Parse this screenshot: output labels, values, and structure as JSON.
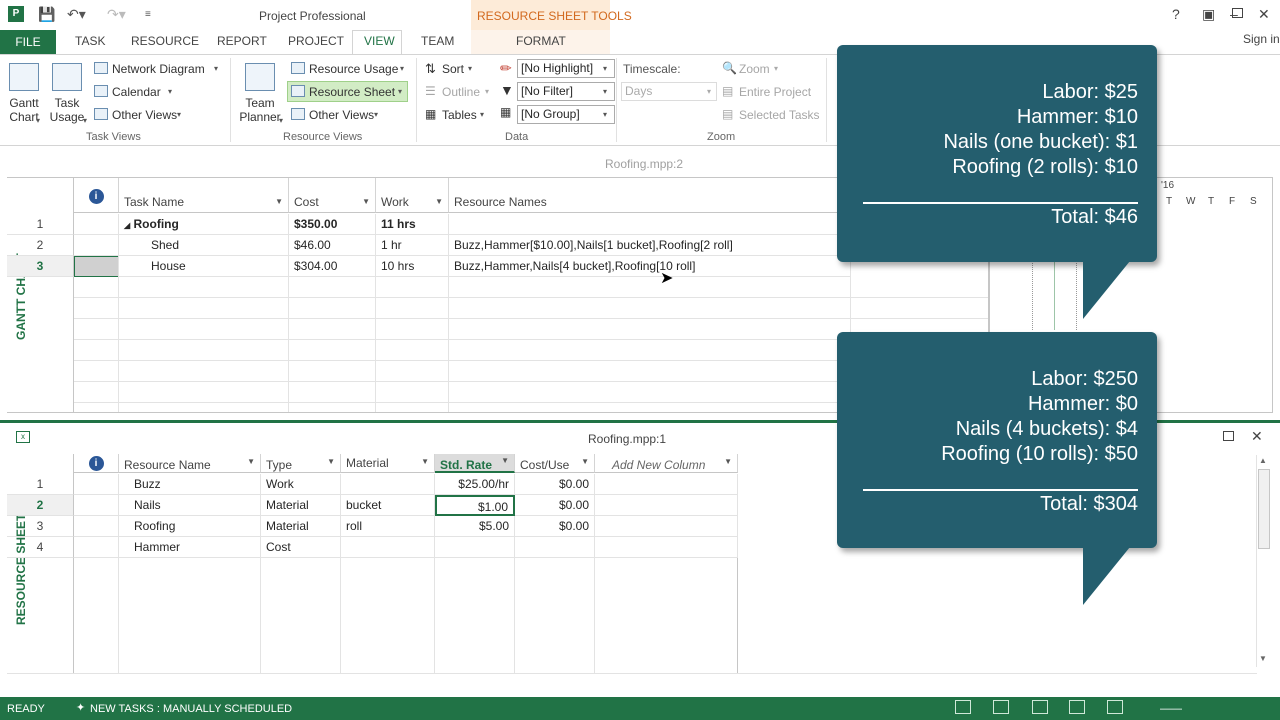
{
  "window": {
    "title": "Project Professional",
    "contextual_tab_group": "RESOURCE SHEET TOOLS",
    "sign_in": "Sign in"
  },
  "tabs": [
    "FILE",
    "TASK",
    "RESOURCE",
    "REPORT",
    "PROJECT",
    "VIEW",
    "TEAM",
    "FORMAT"
  ],
  "ribbon": {
    "task_views": {
      "group_label": "Task Views",
      "gantt_chart": [
        "Gantt",
        "Chart"
      ],
      "task_usage": [
        "Task",
        "Usage"
      ],
      "network_diagram": "Network Diagram",
      "calendar": "Calendar",
      "other_views": "Other Views"
    },
    "resource_views": {
      "group_label": "Resource Views",
      "team_planner": [
        "Team",
        "Planner"
      ],
      "resource_usage": "Resource Usage",
      "resource_sheet": "Resource Sheet",
      "other_views": "Other Views"
    },
    "data": {
      "group_label": "Data",
      "sort": "Sort",
      "outline": "Outline",
      "tables": "Tables",
      "highlight": "[No Highlight]",
      "filter": "[No Filter]",
      "group": "[No Group]"
    },
    "zoom": {
      "group_label": "Zoom",
      "timescale_label": "Timescale:",
      "timescale_value": "Days",
      "zoom": "Zoom",
      "entire_project": "Entire Project",
      "selected_tasks": "Selected Tasks"
    }
  },
  "gantt_pane": {
    "file_name": "Roofing.mpp:2",
    "side_label": "GANTT CHART",
    "columns": [
      "Task Name",
      "Cost",
      "Work",
      "Resource Names"
    ],
    "rows": [
      {
        "id": "1",
        "name": "Roofing",
        "cost": "$350.00",
        "work": "11 hrs",
        "resources": ""
      },
      {
        "id": "2",
        "name": "Shed",
        "cost": "$46.00",
        "work": "1 hr",
        "resources": "Buzz,Hammer[$10.00],Nails[1 bucket],Roofing[2 roll]"
      },
      {
        "id": "3",
        "name": "House",
        "cost": "$304.00",
        "work": "10 hrs",
        "resources": "Buzz,Hammer,Nails[4 bucket],Roofing[10 roll]"
      }
    ],
    "timescale_year": "'16",
    "timescale_days": [
      "T",
      "W",
      "T",
      "F",
      "S"
    ]
  },
  "resource_pane": {
    "file_name": "Roofing.mpp:1",
    "side_label": "RESOURCE SHEET",
    "columns": [
      "Resource Name",
      "Type",
      "Material",
      "Std. Rate",
      "Cost/Use",
      "Add New Column"
    ],
    "rows": [
      {
        "id": "1",
        "name": "Buzz",
        "type": "Work",
        "material": "",
        "rate": "$25.00/hr",
        "cost_use": "$0.00"
      },
      {
        "id": "2",
        "name": "Nails",
        "type": "Material",
        "material": "bucket",
        "rate": "$1.00",
        "cost_use": "$0.00"
      },
      {
        "id": "3",
        "name": "Roofing",
        "type": "Material",
        "material": "roll",
        "rate": "$5.00",
        "cost_use": "$0.00"
      },
      {
        "id": "4",
        "name": "Hammer",
        "type": "Cost",
        "material": "",
        "rate": "",
        "cost_use": ""
      }
    ]
  },
  "callouts": [
    {
      "lines": [
        "Labor: $25",
        "Hammer: $10",
        "Nails (one bucket): $1",
        "Roofing (2 rolls): $10"
      ],
      "total": "Total: $46"
    },
    {
      "lines": [
        "Labor: $250",
        "Hammer: $0",
        "Nails (4 buckets): $4",
        "Roofing (10 rolls): $50"
      ],
      "total": "Total: $304"
    }
  ],
  "status": {
    "ready": "READY",
    "new_tasks": "NEW TASKS : MANUALLY SCHEDULED"
  },
  "colors": {
    "accent": "#217346",
    "callout": "#245e6e",
    "contextual": "#d2691e"
  }
}
